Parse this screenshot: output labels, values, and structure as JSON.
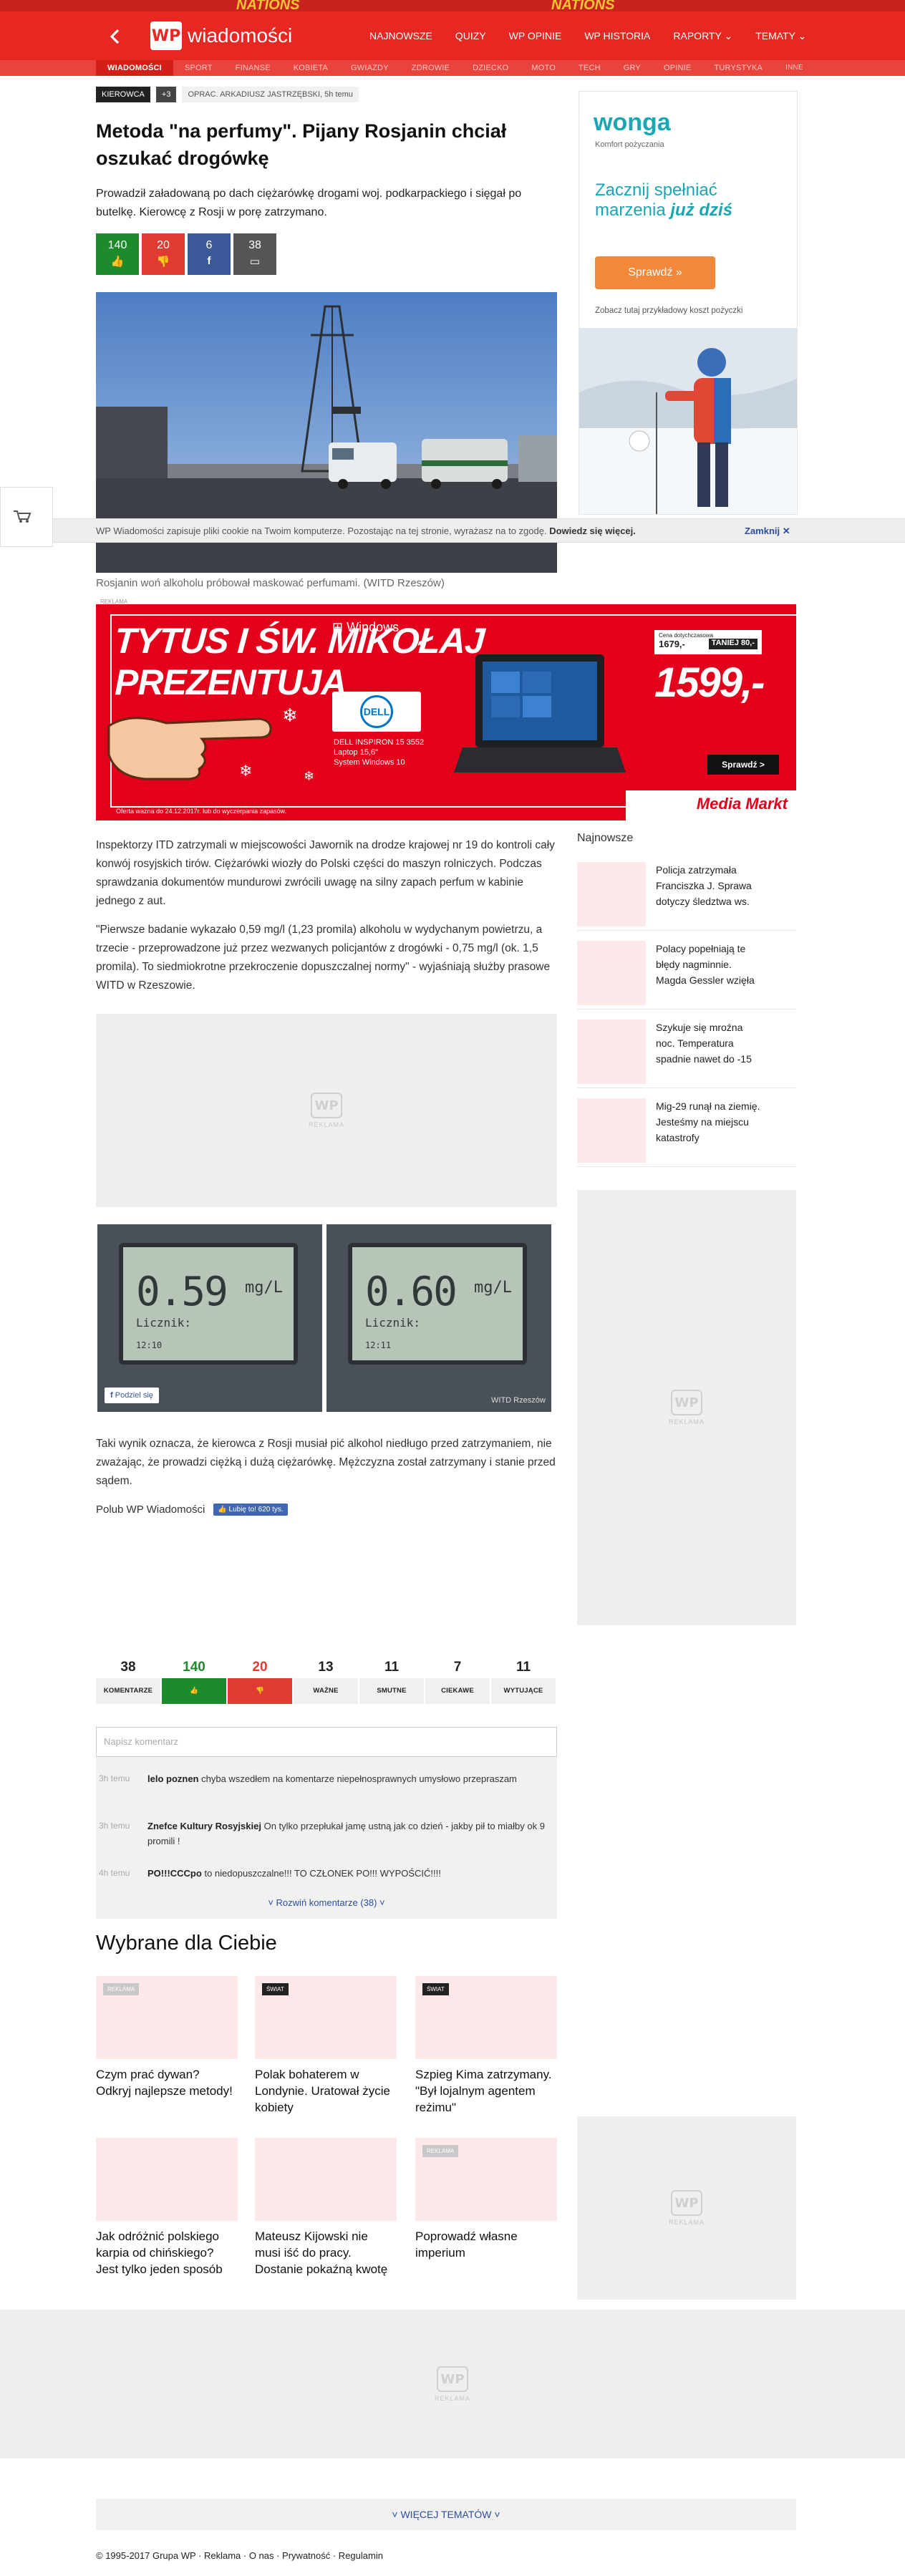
{
  "topstrip": {
    "texts": [
      "NATIONS",
      "NATIONS"
    ]
  },
  "header": {
    "logo_text": "wiadomości",
    "nav": [
      "NAJNOWSZE",
      "QUIZY",
      "WP OPINIE",
      "WP HISTORIA",
      "RAPORTY",
      "TEMATY"
    ]
  },
  "subnav": [
    "WIADOMOŚCI",
    "SPORT",
    "FINANSE",
    "KOBIETA",
    "GWIAZDY",
    "ZDROWIE",
    "DZIECKO",
    "MOTO",
    "TECH",
    "GRY",
    "OPINIE",
    "TURYSTYKA",
    "INNE"
  ],
  "article": {
    "tag1": "KIEROWCA",
    "tag2": "+3",
    "author": "OPRAC. ARKADIUSZ JASTRZĘBSKI, 5h temu",
    "title": "Metoda \"na perfumy\". Pijany Rosjanin chciał oszukać drogówkę",
    "lead": "Prowadził załadowaną po dach ciężarówkę drogami woj. podkarpackiego i sięgał po butelkę. Kierowcę z Rosji w porę zatrzymano.",
    "votes": {
      "up": "140",
      "down": "20",
      "fb": "6",
      "comments": "38"
    },
    "caption": "Rosjanin woń alkoholu próbował maskować perfumami. (WITD Rzeszów)",
    "paragraphs": [
      "Inspektorzy ITD zatrzymali w miejscowości Jawornik na drodze krajowej nr 19 do kontroli cały konwój rosyjskich tirów. Ciężarówki wiozły do Polski części do maszyn rolniczych. Podczas sprawdzania dokumentów mundurowi zwrócili uwagę na silny zapach perfum w kabinie jednego z aut.",
      "\"Pierwsze badanie wykazało 0,59 mg/l (1,23 promila) alkoholu w wydychanym powietrzu, a trzecie - przeprowadzone już przez wezwanych policjantów z drogówki - 0,75 mg/l (ok. 1,5 promila). To siedmiokrotne przekroczenie dopuszczalnej normy\" - wyjaśniają służby prasowe WITD w Rzeszowie."
    ],
    "meter1": {
      "value": "0.59",
      "unit": "mg/L",
      "label": "Licznik:",
      "time": "12:10"
    },
    "meter2": {
      "value": "0.60",
      "unit": "mg/L",
      "label": "Licznik:",
      "time": "12:11"
    },
    "share": "Podziel się",
    "watermark": "WITD Rzeszów",
    "outro": "Taki wynik oznacza, że kierowca z Rosji musiał pić alkohol niedługo przed zatrzymaniem, nie zważając, że prowadzi ciężką i dużą ciężarówkę. Mężczyzna został zatrzymany i stanie przed sądem.",
    "like_text": "Polub WP Wiadomości",
    "like_btn": "👍 Lubię to! 620 tys."
  },
  "cookie": {
    "msg": "WP Wiadomości zapisuje pliki cookie na Twoim komputerze. Pozostając na tej stronie, wyrażasz na to zgodę.",
    "link": "Dowiedz się więcej.",
    "close": "Zamknij"
  },
  "ads": {
    "reklama": "REKLAMA",
    "wonga_brand": "wonga",
    "wonga_sub": "Komfort pożyczania",
    "wonga_line1": "Zacznij spełniać",
    "wonga_line2": "marzenia",
    "wonga_line2b": "już dziś",
    "wonga_btn": "Sprawdź »",
    "wonga_note": "Zobacz tutaj przykładowy koszt pożyczki",
    "mm_line1": "TYTUS I ŚW. MIKOŁAJ",
    "mm_line2": "PREZENTUJĄ",
    "mm_windows": "Windows",
    "mm_dell": "DELL",
    "mm_model1": "DELL INSPIRON 15 3552",
    "mm_model2": "Laptop 15,6\"",
    "mm_model3": "System Windows 10",
    "mm_oldprice_label": "Cena dotychczasowa",
    "mm_oldprice": "1679,-",
    "mm_save": "TANIEJ 80,-",
    "mm_price": "1599,-",
    "mm_btn": "Sprawdź >",
    "mm_note": "Oferta ważna do 24.12.2017r. lub do wyczerpania zapasów.",
    "mm_logo": "Media Markt"
  },
  "newest": {
    "title": "Najnowsze",
    "items": [
      "Policja zatrzymała Franciszka J. Sprawa dotyczy śledztwa ws.",
      "Polacy popełniają te błędy nagminnie. Magda Gessler wzięła",
      "Szykuje się mroźna noc. Temperatura spadnie nawet do -15",
      "Mig-29 runął na ziemię. Jesteśmy na miejscu katastrofy"
    ]
  },
  "reactions": [
    {
      "n": "38",
      "label": "KOMENTARZE"
    },
    {
      "n": "140",
      "label": "👍"
    },
    {
      "n": "20",
      "label": "👎"
    },
    {
      "n": "13",
      "label": "WAŻNE"
    },
    {
      "n": "11",
      "label": "SMUTNE"
    },
    {
      "n": "7",
      "label": "CIEKAWE"
    },
    {
      "n": "11",
      "label": "WYTUJĄCE"
    }
  ],
  "comments": {
    "placeholder": "Napisz komentarz",
    "items": [
      {
        "time": "3h temu",
        "user": "lelo poznen",
        "text": "chyba wszedłem na komentarze niepełnosprawnych umysłowo przepraszam"
      },
      {
        "time": "3h temu",
        "user": "Znefce Kultury Rosyjskiej",
        "text": "On tylko przepłukał jamę ustną jak co dzień - jakby pił to miałby ok 9 promili !"
      },
      {
        "time": "4h temu",
        "user": "PO!!!CCCpo",
        "text": "to niedopuszczalne!!! TO CZŁONEK PO!!! WYPOŚCIĆ!!!!"
      }
    ],
    "more": "˅ Rozwiń komentarze (38) ˅"
  },
  "recommended": {
    "title": "Wybrane dla Ciebie",
    "cards": [
      {
        "badge": "REKLAMA",
        "title": "Czym prać dywan? Odkryj najlepsze metody!"
      },
      {
        "badge": "ŚWIAT",
        "title": "Polak bohaterem w Londynie. Uratował życie kobiety"
      },
      {
        "badge": "ŚWIAT",
        "title": "Szpieg Kima zatrzymany. \"Był lojalnym agentem reżimu\""
      },
      {
        "badge": "",
        "title": "Jak odróżnić polskiego karpia od chińskiego? Jest tylko jeden sposób"
      },
      {
        "badge": "",
        "title": "Mateusz Kijowski nie musi iść do pracy. Dostanie pokaźną kwotę"
      },
      {
        "badge": "REKLAMA",
        "title": "Poprowadź własne imperium"
      }
    ]
  },
  "more_topics": "˅ WIĘCEJ TEMATÓW ˅",
  "footer": "© 1995-2017 Grupa WP  ·  Reklama  ·  O nas  ·  Prywatność  ·  Regulamin"
}
